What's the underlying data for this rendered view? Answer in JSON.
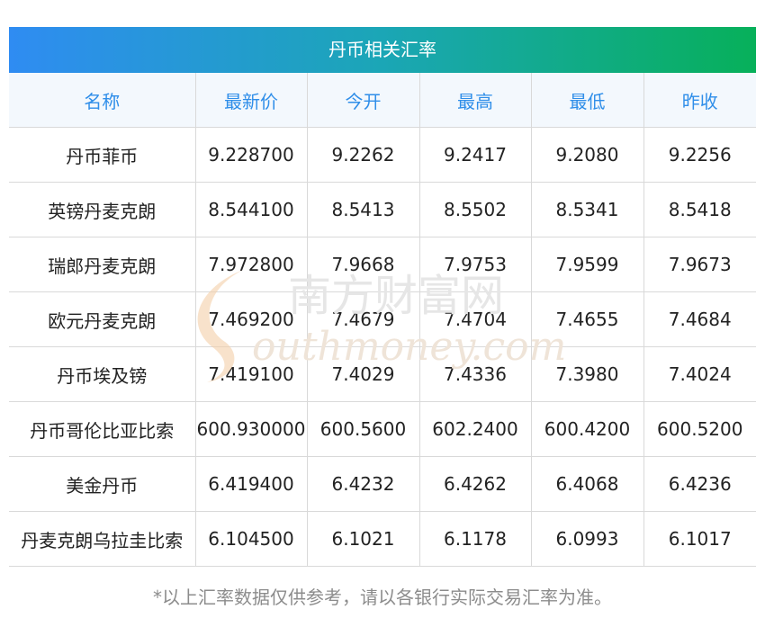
{
  "title": "丹币相关汇率",
  "columns": [
    "名称",
    "最新价",
    "今开",
    "最高",
    "最低",
    "昨收"
  ],
  "rows": [
    [
      "丹币菲币",
      "9.228700",
      "9.2262",
      "9.2417",
      "9.2080",
      "9.2256"
    ],
    [
      "英镑丹麦克朗",
      "8.544100",
      "8.5413",
      "8.5502",
      "8.5341",
      "8.5418"
    ],
    [
      "瑞郎丹麦克朗",
      "7.972800",
      "7.9668",
      "7.9753",
      "7.9599",
      "7.9673"
    ],
    [
      "欧元丹麦克朗",
      "7.469200",
      "7.4679",
      "7.4704",
      "7.4655",
      "7.4684"
    ],
    [
      "丹币埃及镑",
      "7.419100",
      "7.4029",
      "7.4336",
      "7.3980",
      "7.4024"
    ],
    [
      "丹币哥伦比亚比索",
      "600.930000",
      "600.5600",
      "602.2400",
      "600.4200",
      "600.5200"
    ],
    [
      "美金丹币",
      "6.419400",
      "6.4232",
      "6.4262",
      "6.4068",
      "6.4236"
    ],
    [
      "丹麦克朗乌拉圭比索",
      "6.104500",
      "6.1021",
      "6.1178",
      "6.0993",
      "6.1017"
    ]
  ],
  "footnote": "*以上汇率数据仅供参考，请以各银行实际交易汇率为准。",
  "watermark": {
    "text_cn": "南方财富网",
    "text_en": "outhmoney.com"
  },
  "colors": {
    "header_text": "#2f8ee9",
    "gradient_start": "#2f8cf2",
    "gradient_end": "#07b05a"
  }
}
